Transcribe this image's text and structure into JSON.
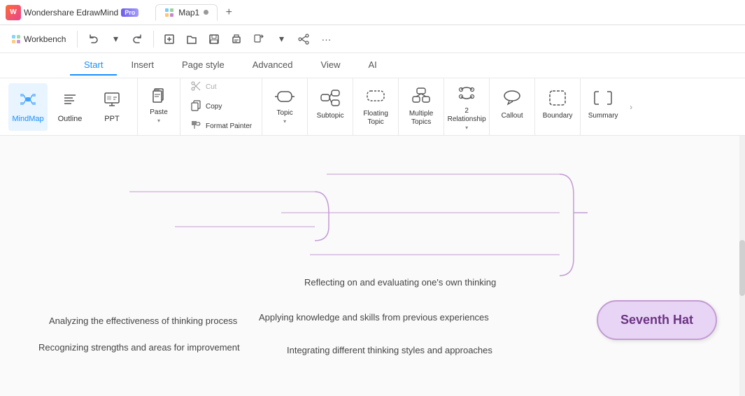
{
  "app": {
    "name": "Wondershare EdrawMind",
    "pro_badge": "Pro",
    "tab_name": "Map1"
  },
  "workbench": {
    "label": "Workbench"
  },
  "nav_tabs": [
    {
      "id": "start",
      "label": "Start",
      "active": true
    },
    {
      "id": "insert",
      "label": "Insert",
      "active": false
    },
    {
      "id": "page_style",
      "label": "Page style",
      "active": false
    },
    {
      "id": "advanced",
      "label": "Advanced",
      "active": false
    },
    {
      "id": "view",
      "label": "View",
      "active": false
    },
    {
      "id": "ai",
      "label": "AI",
      "active": false
    }
  ],
  "mode_panel": {
    "mindmap": {
      "label": "MindMap",
      "icon": "🗺"
    },
    "outline": {
      "label": "Outline",
      "icon": "☰"
    },
    "ppt": {
      "label": "PPT",
      "icon": "📊"
    }
  },
  "ribbon": {
    "paste": {
      "label": "Paste",
      "icon": "📋"
    },
    "cut": {
      "label": "Cut",
      "icon": "✂"
    },
    "copy": {
      "label": "Copy",
      "icon": "⧉"
    },
    "format_painter": {
      "label": "Format Painter",
      "icon": "🖌"
    },
    "topic": {
      "label": "Topic",
      "icon": "⬜"
    },
    "subtopic": {
      "label": "Subtopic",
      "icon": "⬜"
    },
    "floating_topic": {
      "label": "Floating Topic",
      "icon": "⬡"
    },
    "multiple_topics": {
      "label": "Multiple Topics",
      "icon": "⬜"
    },
    "relationship": {
      "label": "2 Relationship",
      "icon": "↩"
    },
    "callout": {
      "label": "Callout",
      "icon": "⬡"
    },
    "boundary": {
      "label": "Boundary",
      "icon": "⬜"
    },
    "summary": {
      "label": "Summary",
      "icon": "}"
    }
  },
  "canvas": {
    "node_central": "Seventh Hat",
    "bullets_right": [
      "Reflecting on and evaluating one's own thinking",
      "Applying knowledge and skills from previous experiences",
      "Integrating different thinking styles and approaches"
    ],
    "bullets_left": [
      "Analyzing the effectiveness of thinking process",
      "Recognizing strengths and areas for improvement"
    ]
  }
}
